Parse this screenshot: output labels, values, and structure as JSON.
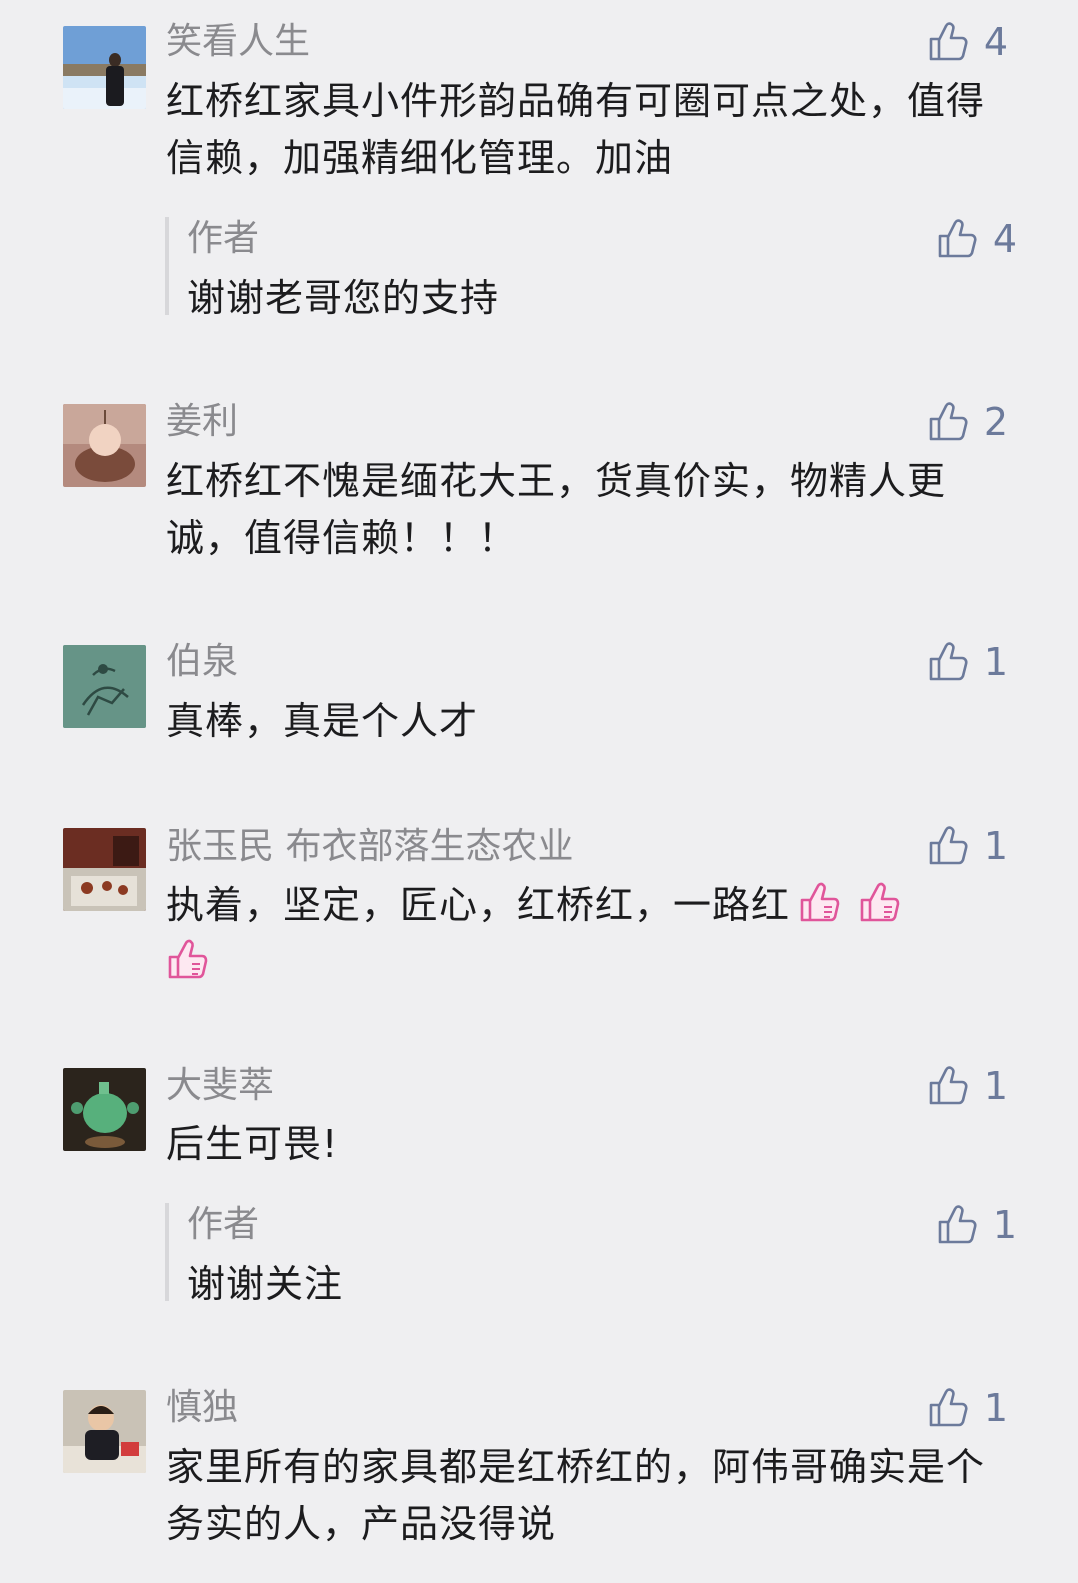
{
  "comments": [
    {
      "name": "笑看人生",
      "text": "红桥红家具小件形韵品确有可圈可点之处，值得信赖，加强精细化管理。加油",
      "likes": "4",
      "reply": {
        "name": "作者",
        "text": "谢谢老哥您的支持",
        "likes": "4"
      }
    },
    {
      "name": "姜利",
      "text": "红桥红不愧是缅花大王，货真价实，物精人更诚，值得信赖！！！",
      "likes": "2"
    },
    {
      "name": "伯泉",
      "text": "真棒，真是个人才",
      "likes": "1"
    },
    {
      "name": "张玉民 布衣部落生态农业",
      "text": "执着，坚定，匠心，红桥红，一路红",
      "likes": "1",
      "emojis": [
        "thumbs-up-emoji",
        "thumbs-up-emoji",
        "thumbs-up-emoji"
      ]
    },
    {
      "name": "大斐萃",
      "text": "后生可畏!",
      "likes": "1",
      "reply": {
        "name": "作者",
        "text": "谢谢关注",
        "likes": "1"
      }
    },
    {
      "name": "慎独",
      "text": "家里所有的家具都是红桥红的，阿伟哥确实是个务实的人，产品没得说",
      "likes": "1"
    }
  ],
  "colors": {
    "background": "#efeff1",
    "name": "#8a8a8e",
    "text": "#1c1c1e",
    "like": "#6c7a9b",
    "emoji": "#e0559a"
  },
  "icons": {
    "like": "thumbs-up-outline-icon",
    "emoji": "thumbs-up-emoji"
  }
}
